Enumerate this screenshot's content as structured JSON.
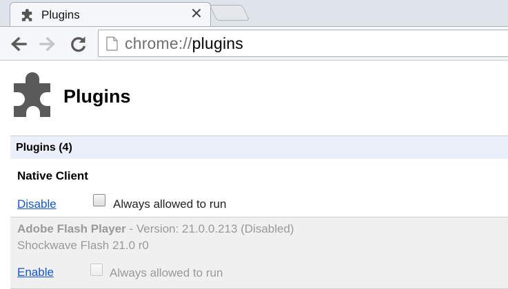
{
  "tab": {
    "title": "Plugins",
    "icon": "puzzle-icon"
  },
  "toolbar": {
    "url_scheme": "chrome://",
    "url_host": "plugins",
    "page_icon": "page-icon"
  },
  "page": {
    "title": "Plugins",
    "icon": "puzzle-icon"
  },
  "section": {
    "title": "Plugins (4)"
  },
  "plugins": [
    {
      "name": "Native Client",
      "action": "Disable",
      "always_allowed_label": "Always allowed to run",
      "always_allowed_checked": false,
      "disabled": false
    },
    {
      "name": "Adobe Flash Player",
      "version_text": "- Version: 21.0.0.213 (Disabled)",
      "description": "Shockwave Flash 21.0 r0",
      "action": "Enable",
      "always_allowed_label": "Always allowed to run",
      "always_allowed_checked": false,
      "disabled": true
    }
  ],
  "colors": {
    "link": "#1155cc",
    "section_bg": "#ebeff9",
    "disabled_bg": "#f0f0f0",
    "disabled_text": "#999999",
    "icon": "#5a5a5a"
  }
}
